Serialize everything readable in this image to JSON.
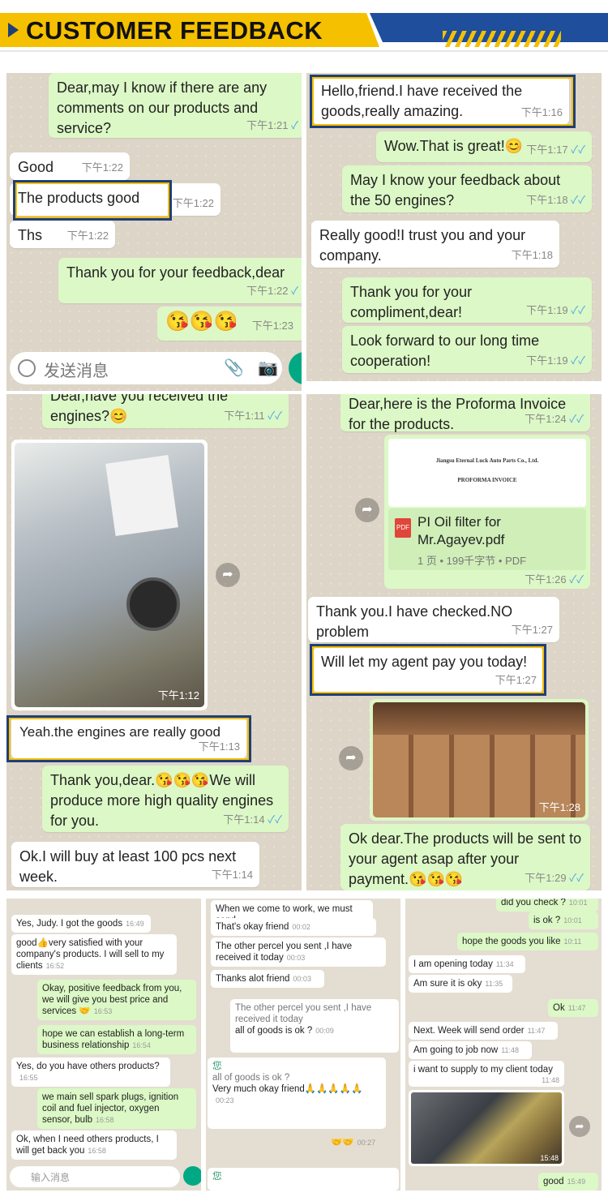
{
  "header": {
    "title": "CUSTOMER FEEDBACK"
  },
  "colors": {
    "yellow": "#f5c000",
    "blue": "#1f4e9c",
    "bubble_out": "#dcf8c6",
    "bubble_in": "#ffffff"
  },
  "p1": {
    "m1": {
      "text": "Dear,may I know if there are any comments on our products and service?",
      "time": "下午1:21"
    },
    "m2": {
      "text": "Good",
      "time": "下午1:22"
    },
    "m3": {
      "text": "The products good",
      "time": "下午1:22"
    },
    "m4": {
      "text": "Ths",
      "time": "下午1:22"
    },
    "m5": {
      "text": "Thank you for your feedback,dear",
      "time": "下午1:22"
    },
    "m6": {
      "text": "😘😘😘",
      "time": "下午1:23"
    },
    "input": {
      "placeholder": "发送消息",
      "icon_emoji": "emoji-icon",
      "icon_clip": "paperclip-icon",
      "icon_cam": "camera-icon"
    }
  },
  "p2": {
    "m1": {
      "text": "Hello,friend.I have received the goods,really amazing.",
      "time": "下午1:16"
    },
    "m2": {
      "text": "Wow.That is great!😊",
      "time": "下午1:17"
    },
    "m3": {
      "text": "May I know your feedback about the 50 engines?",
      "time": "下午1:18"
    },
    "m4": {
      "text": "Really good!I trust you and your company.",
      "time": "下午1:18"
    },
    "m5": {
      "text": "Thank you for your compliment,dear!",
      "time": "下午1:19"
    },
    "m6": {
      "text": "Look forward to our long time cooperation!",
      "time": "下午1:19"
    }
  },
  "p3": {
    "m1": {
      "text": "Dear,have you received the engines?😊",
      "time": "下午1:11"
    },
    "photo": {
      "time": "下午1:12",
      "label": "engine-photo"
    },
    "m2": {
      "text": "Yeah.the engines are really good",
      "time": "下午1:13"
    },
    "m3": {
      "text": "Thank you,dear.😘😘😘We will produce more high quality engines for you.",
      "time": "下午1:14"
    },
    "m4": {
      "text": "Ok.I will buy at least 100 pcs next week.",
      "time": "下午1:14"
    }
  },
  "p4": {
    "m1": {
      "text": "Dear,here is the Proforma Invoice for the products.",
      "time": "下午1:24"
    },
    "doc": {
      "company": "Jiangsu Eternal Luck Auto Parts Co., Ltd.",
      "heading": "PROFORMA INVOICE",
      "filename": "PI Oil filter for Mr.Agayev.pdf",
      "meta": "1 页 • 199千字节 • PDF",
      "badge": "PDF",
      "time": "下午1:26"
    },
    "m2": {
      "text": "Thank you.I  have checked.NO problem",
      "time": "下午1:27"
    },
    "m3": {
      "text": "Will let my agent pay you today!",
      "time": "下午1:27"
    },
    "photo": {
      "time": "下午1:28"
    },
    "m4": {
      "text": "Ok dear.The products will be sent to your agent asap after your payment.😘😘😘",
      "time": "下午1:29"
    }
  },
  "s1": {
    "items": [
      {
        "text": "Yes, Judy. I got the goods",
        "time": "16:49"
      },
      {
        "text": "good👍very satisfied with your company's products. I will sell to my clients",
        "time": "16:52"
      },
      {
        "text": "Okay, positive feedback from you, we will give you best price and services 🤝",
        "time": "16:53"
      },
      {
        "text": "hope we can establish a long-term business relationship",
        "time": "16:54"
      },
      {
        "text": "Yes, do you have others products?",
        "time": "16:55"
      },
      {
        "text": "we main sell spark plugs, ignition coil and fuel injector, oxygen sensor, bulb",
        "time": "16:58"
      },
      {
        "text": "Ok, when I need others products, I will get back you",
        "time": "16:58"
      }
    ],
    "input": {
      "placeholder": "输入消息"
    }
  },
  "s2": {
    "items": [
      {
        "text": "When we come to work, we must send",
        "time": ""
      },
      {
        "text": "That's okay friend",
        "time": "00:02"
      },
      {
        "text": "The other percel you sent ,I have received it today",
        "time": "00:03"
      },
      {
        "text": "Thanks alot friend",
        "time": "00:03"
      },
      {
        "text": "The other percel you sent ,I have received it today",
        "time": ""
      },
      {
        "text": "all of goods is ok ?",
        "time": "00:09"
      },
      {
        "text": "您",
        "time": ""
      },
      {
        "text": "all of goods is ok ?",
        "time": ""
      },
      {
        "text": "Very much okay friend🙏🙏🙏🙏🙏",
        "time": "00:23"
      },
      {
        "text": "🤝🤝",
        "time": "00:27"
      },
      {
        "text": "您",
        "time": ""
      }
    ]
  },
  "s3": {
    "items": [
      {
        "text": "did you check ?",
        "time": "10:01"
      },
      {
        "text": "is ok ?",
        "time": "10:01"
      },
      {
        "text": "hope the goods you like",
        "time": "10:11"
      },
      {
        "text": "I am opening today",
        "time": "11:34"
      },
      {
        "text": "Am sure it is oky",
        "time": "11:35"
      },
      {
        "text": "Ok",
        "time": "11:47"
      },
      {
        "text": "Next. Week will send order",
        "time": "11:47"
      },
      {
        "text": "Am going to job now",
        "time": "11:48"
      },
      {
        "text": "i want to supply to my client today",
        "time": "11:48"
      },
      {
        "text": "",
        "time": "15:48"
      },
      {
        "text": "good",
        "time": "15:49"
      }
    ]
  }
}
